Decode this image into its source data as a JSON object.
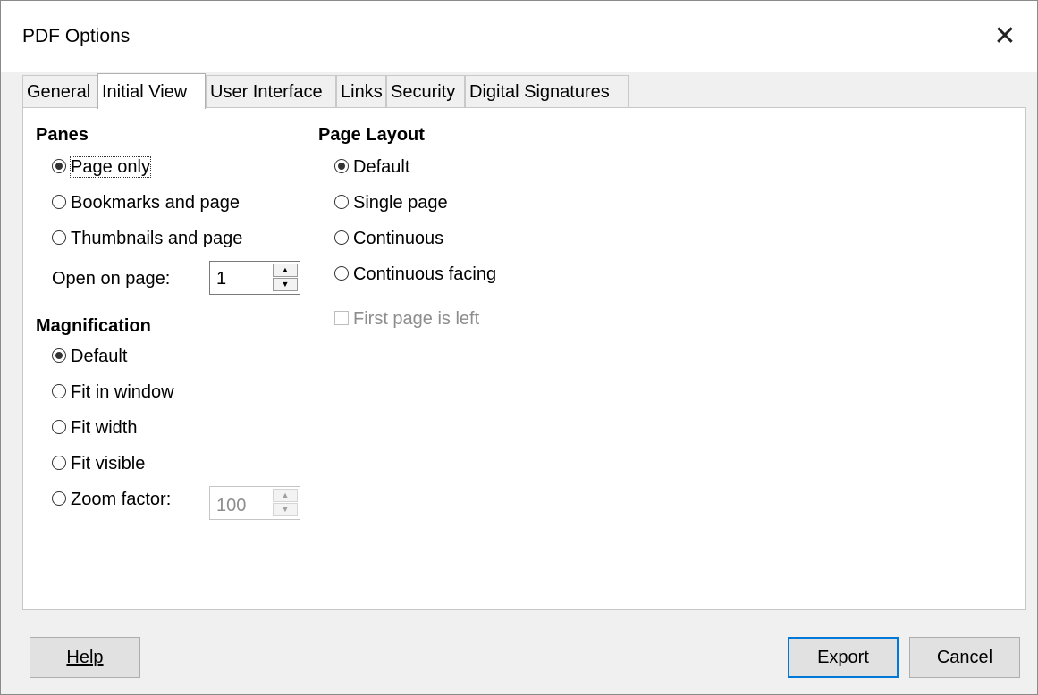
{
  "window": {
    "title": "PDF Options",
    "close_label": "✕"
  },
  "tabs": [
    {
      "label": "General"
    },
    {
      "label": "Initial View"
    },
    {
      "label": "User Interface"
    },
    {
      "label": "Links"
    },
    {
      "label": "Security"
    },
    {
      "label": "Digital Signatures"
    }
  ],
  "active_tab": "Initial View",
  "panes": {
    "heading": "Panes",
    "options": [
      {
        "label": "Page only",
        "checked": true
      },
      {
        "label": "Bookmarks and page",
        "checked": false
      },
      {
        "label": "Thumbnails and page",
        "checked": false
      }
    ],
    "open_on_page_label": "Open on page:",
    "open_on_page_value": "1"
  },
  "magnification": {
    "heading": "Magnification",
    "options": [
      {
        "label": "Default",
        "checked": true
      },
      {
        "label": "Fit in window",
        "checked": false
      },
      {
        "label": "Fit width",
        "checked": false
      },
      {
        "label": "Fit visible",
        "checked": false
      },
      {
        "label": "Zoom factor:",
        "checked": false
      }
    ],
    "zoom_value": "100"
  },
  "page_layout": {
    "heading": "Page Layout",
    "options": [
      {
        "label": "Default",
        "checked": true
      },
      {
        "label": "Single page",
        "checked": false
      },
      {
        "label": "Continuous",
        "checked": false
      },
      {
        "label": "Continuous facing",
        "checked": false
      }
    ],
    "first_page_left_label": "First page is left",
    "first_page_left_checked": false,
    "first_page_left_enabled": false
  },
  "buttons": {
    "help": "Help",
    "export": "Export",
    "cancel": "Cancel"
  },
  "icons": {
    "spin_up": "▲",
    "spin_down": "▼"
  }
}
